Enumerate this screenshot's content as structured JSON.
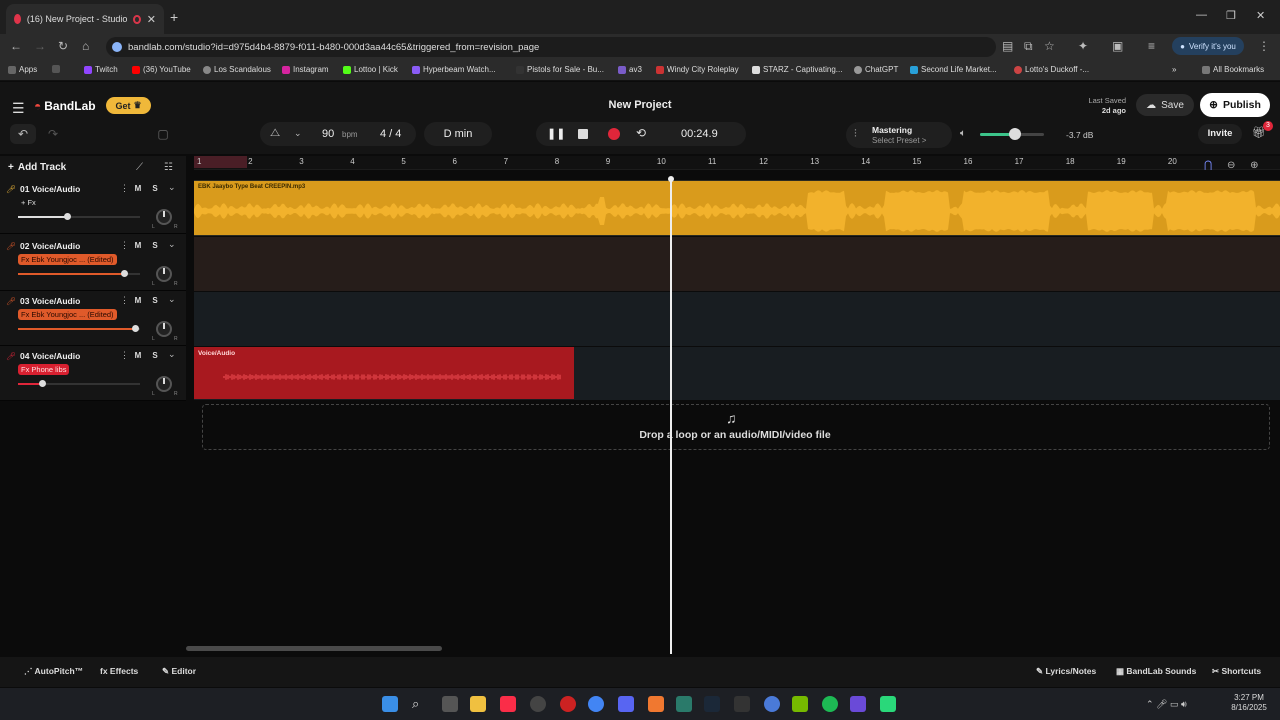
{
  "browser": {
    "tab_title": "(16) New Project - Studio",
    "tab_close": "✕",
    "new_tab": "+",
    "window_controls": [
      "—",
      "❐",
      "✕"
    ],
    "url": "bandlab.com/studio?id=d975d4b4-8879-f011-b480-000d3aa44c65&triggered_from=revision_page",
    "verify_label": "Verify it's you",
    "bookmarks": [
      "Apps",
      "Twitch",
      "(36) YouTube",
      "Los Scandalous",
      "Instagram",
      "Lottoo | Kick",
      "Hyperbeam Watch...",
      "Pistols for Sale - Bu...",
      "av3",
      "Windy City Roleplay",
      "STARZ - Captivating...",
      "ChatGPT",
      "Second Life Market...",
      "Lotto's Duckoff -..."
    ],
    "all_bookmarks": "All Bookmarks"
  },
  "app": {
    "logo": "BandLab",
    "get_label": "Get",
    "project_title": "New Project",
    "last_saved_label": "Last Saved",
    "last_saved_value": "2d ago",
    "save_label": "Save",
    "publish_label": "Publish",
    "invite_label": "Invite",
    "gift_count": "3"
  },
  "transport": {
    "tempo": "90",
    "bpm_label": "bpm",
    "time_signature": "4 / 4",
    "key": "D min",
    "time": "00:24.9"
  },
  "mastering": {
    "title": "Mastering",
    "preset": "Select Preset  >"
  },
  "volume": {
    "db": "-3.7 dB",
    "level": 0.55
  },
  "tracks_header": {
    "add_track": "Add Track"
  },
  "tracks": [
    {
      "name": "01 Voice/Audio",
      "fx": "+ Fx",
      "fx_style": "plain",
      "fader": 0.4,
      "mic_color": "#f0b83a"
    },
    {
      "name": "02 Voice/Audio",
      "fx": "Fx Ebk Youngjoc ... (Edited)",
      "fx_style": "orange",
      "fader": 0.87,
      "mic_color": "#e05a2a"
    },
    {
      "name": "03 Voice/Audio",
      "fx": "Fx Ebk Youngjoc ... (Edited)",
      "fx_style": "orange",
      "fader": 0.96,
      "mic_color": "#e05a2a"
    },
    {
      "name": "04 Voice/Audio",
      "fx": "Fx Phone libs",
      "fx_style": "red",
      "fader": 0.2,
      "mic_color": "#e0263a"
    }
  ],
  "mute_label": "M",
  "solo_label": "S",
  "pan_left": "L",
  "pan_right": "R",
  "ruler_bars": [
    "1",
    "2",
    "3",
    "4",
    "5",
    "6",
    "7",
    "8",
    "9",
    "10",
    "11",
    "12",
    "13",
    "14",
    "15",
    "16",
    "17",
    "18",
    "19",
    "20"
  ],
  "clips": {
    "clip1_label": "EBK Jaaybo Type Beat  CREEPIN.mp3",
    "clip4_label": "Voice/Audio"
  },
  "dropzone_text": "Drop a loop or an audio/MIDI/video file",
  "bottom_tools": {
    "autopitch": "AutoPitch™",
    "effects": "Effects",
    "editor": "Editor",
    "lyrics": "Lyrics/Notes",
    "sounds": "BandLab Sounds",
    "shortcuts": "Shortcuts"
  },
  "taskbar": {
    "time": "3:27 PM",
    "date": "8/16/2025"
  }
}
